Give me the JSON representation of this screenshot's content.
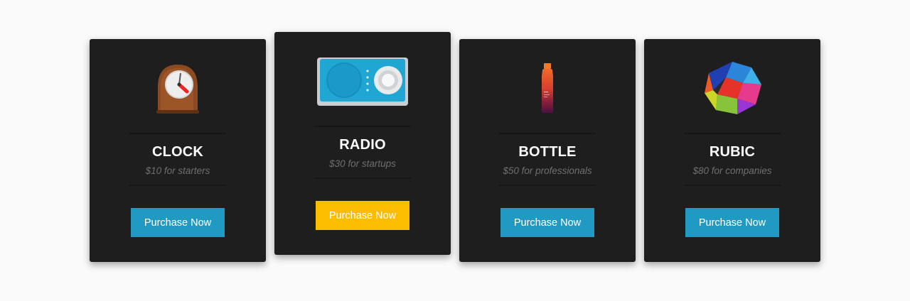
{
  "plans": [
    {
      "name": "CLOCK",
      "price": "$10 for starters",
      "button": "Purchase Now",
      "button_color": "#209ac3",
      "featured": false,
      "image": "clock-image"
    },
    {
      "name": "RADIO",
      "price": "$30 for startups",
      "button": "Purchase Now",
      "button_color": "#fcbc00",
      "featured": true,
      "image": "radio-image"
    },
    {
      "name": "BOTTLE",
      "price": "$50 for professionals",
      "button": "Purchase Now",
      "button_color": "#209ac3",
      "featured": false,
      "image": "bottle-image"
    },
    {
      "name": "RUBIC",
      "price": "$80 for companies",
      "button": "Purchase Now",
      "button_color": "#209ac3",
      "featured": false,
      "image": "rubic-image"
    }
  ],
  "colors": {
    "page_bg": "#fafafa",
    "card_bg": "#1e1e1e",
    "accent_blue": "#209ac3",
    "accent_yellow": "#fcbc00"
  }
}
